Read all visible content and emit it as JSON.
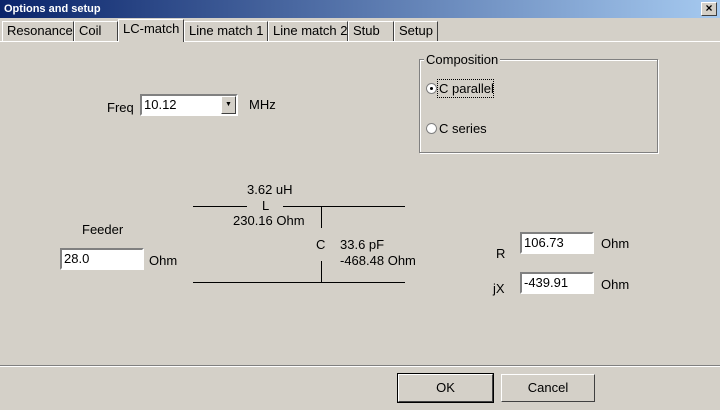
{
  "window": {
    "title": "Options and setup",
    "close_glyph": "×"
  },
  "tabs": [
    {
      "label": "Resonance"
    },
    {
      "label": "Coil"
    },
    {
      "label": "LC-match"
    },
    {
      "label": "Line match  1"
    },
    {
      "label": "Line match 2"
    },
    {
      "label": "Stub"
    },
    {
      "label": "Setup"
    }
  ],
  "freq": {
    "label": "Freq",
    "value": "10.12",
    "unit": "MHz"
  },
  "composition": {
    "title": "Composition",
    "options": [
      {
        "label": "C parallel",
        "checked": true
      },
      {
        "label": "C series",
        "checked": false
      }
    ]
  },
  "circuit": {
    "l_value": "3.62 uH",
    "l_label": "L",
    "l_impedance": "230.16 Ohm",
    "c_label": "C",
    "c_value": "33.6 pF",
    "c_impedance": "-468.48 Ohm"
  },
  "feeder": {
    "label": "Feeder",
    "value": "28.0",
    "unit": "Ohm"
  },
  "load": {
    "r_label": "R",
    "r_value": "106.73",
    "r_unit": "Ohm",
    "jx_label": "jX",
    "jx_value": "-439.91",
    "jx_unit": "Ohm"
  },
  "buttons": {
    "ok": "OK",
    "cancel": "Cancel"
  }
}
